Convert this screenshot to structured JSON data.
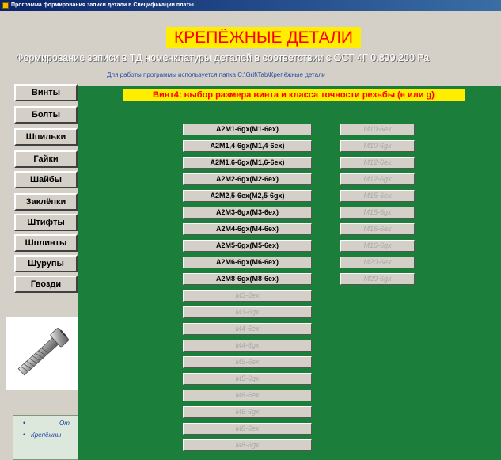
{
  "window": {
    "title": "Программа формирования записи детали в Спецификации платы"
  },
  "header": {
    "banner": "КРЕПЁЖНЫЕ ДЕТАЛИ",
    "subtitle": "Формирование записи в ТД номенклатуры деталей в соответствии с ОСТ 4Г 0.899.200  Ра",
    "folder_note": "Для работы программы используется папка  C:\\Grif\\Tab\\Крепёжные детали"
  },
  "sidebar": {
    "items": [
      {
        "label": "Винты"
      },
      {
        "label": "Болты"
      },
      {
        "label": "Шпильки"
      },
      {
        "label": "Гайки"
      },
      {
        "label": "Шайбы"
      },
      {
        "label": "Заклёпки"
      },
      {
        "label": "Штифты"
      },
      {
        "label": "Шплинты"
      },
      {
        "label": "Шурупы"
      },
      {
        "label": "Гвозди"
      }
    ]
  },
  "info": {
    "line1": "От",
    "line2": "Крепёжны"
  },
  "panel": {
    "heading": "Винт4: выбор размера винта и класса точности резьбы (e или g)",
    "left_column": [
      {
        "label": "A2M1-6gx(M1-6ex)",
        "enabled": true
      },
      {
        "label": "A2M1,4-6gx(M1,4-6ex)",
        "enabled": true
      },
      {
        "label": "A2M1,6-6gx(M1,6-6ex)",
        "enabled": true
      },
      {
        "label": "A2M2-6gx(M2-6ex)",
        "enabled": true
      },
      {
        "label": "A2M2,5-6ex(M2,5-6gx)",
        "enabled": true
      },
      {
        "label": "A2M3-6gx(M3-6ex)",
        "enabled": true
      },
      {
        "label": "A2M4-6gx(M4-6ex)",
        "enabled": true
      },
      {
        "label": "A2M5-6gx(M5-6ex)",
        "enabled": true
      },
      {
        "label": "A2M6-6gx(M6-6ex)",
        "enabled": true
      },
      {
        "label": "A2M8-6gx(M8-6ex)",
        "enabled": true
      },
      {
        "label": "M3-6ex",
        "enabled": false
      },
      {
        "label": "M3-6gx",
        "enabled": false
      },
      {
        "label": "M4-6ex",
        "enabled": false
      },
      {
        "label": "M4-6gx",
        "enabled": false
      },
      {
        "label": "M5-6ex",
        "enabled": false
      },
      {
        "label": "M5-6gx",
        "enabled": false
      },
      {
        "label": "M6-6ex",
        "enabled": false
      },
      {
        "label": "M6-6gx",
        "enabled": false
      },
      {
        "label": "M8-6ex",
        "enabled": false
      },
      {
        "label": "M8-6gx",
        "enabled": false
      }
    ],
    "right_column": [
      {
        "label": "M10-6ex",
        "enabled": false
      },
      {
        "label": "M10-6gx",
        "enabled": false
      },
      {
        "label": "M12-6ex",
        "enabled": false
      },
      {
        "label": "M12-6gx",
        "enabled": false
      },
      {
        "label": "M15-6ex",
        "enabled": false
      },
      {
        "label": "M15-6gx",
        "enabled": false
      },
      {
        "label": "M16-6ex",
        "enabled": false
      },
      {
        "label": "M16-6gx",
        "enabled": false
      },
      {
        "label": "M20-6ex",
        "enabled": false
      },
      {
        "label": "M20-6gx",
        "enabled": false
      }
    ]
  }
}
